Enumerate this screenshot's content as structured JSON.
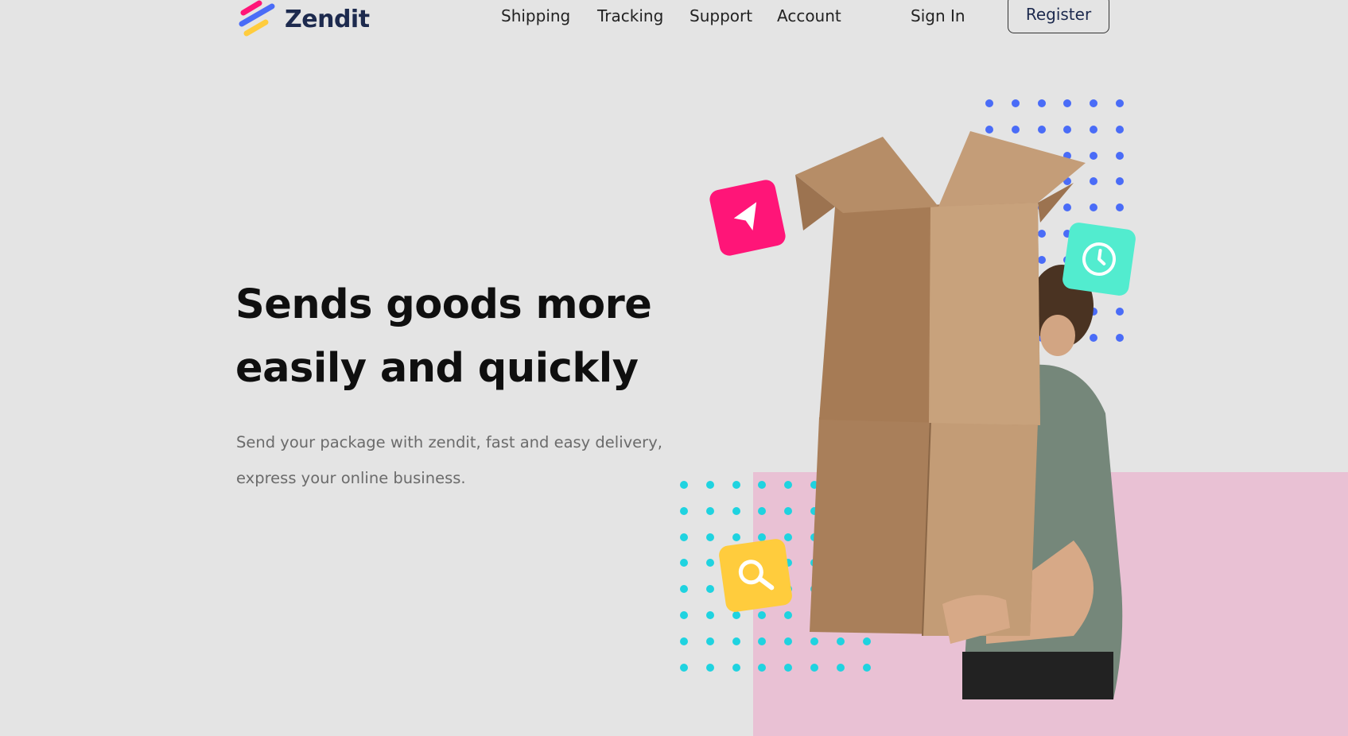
{
  "brand": {
    "name": "Zendit"
  },
  "nav": {
    "links": [
      "Shipping",
      "Tracking",
      "Support",
      "Account"
    ],
    "sign_in": "Sign In",
    "register": "Register"
  },
  "hero": {
    "title_line1": "Sends goods more",
    "title_line2": "easily and quickly",
    "subtitle_line1": "Send your package with zendit, fast and easy delivery,",
    "subtitle_line2": "express your online business."
  },
  "icons": {
    "send": "send-arrow-icon",
    "clock": "clock-icon",
    "search": "search-icon"
  },
  "colors": {
    "background": "#e4e4e4",
    "pink_panel": "#e9c1d4",
    "blue_dots": "#4a6cf7",
    "cyan_dots": "#1fd3e0",
    "send_tile": "#ff1578",
    "clock_tile": "#52eccf",
    "search_tile": "#ffcc3d",
    "brand_text": "#1d2a4e"
  }
}
